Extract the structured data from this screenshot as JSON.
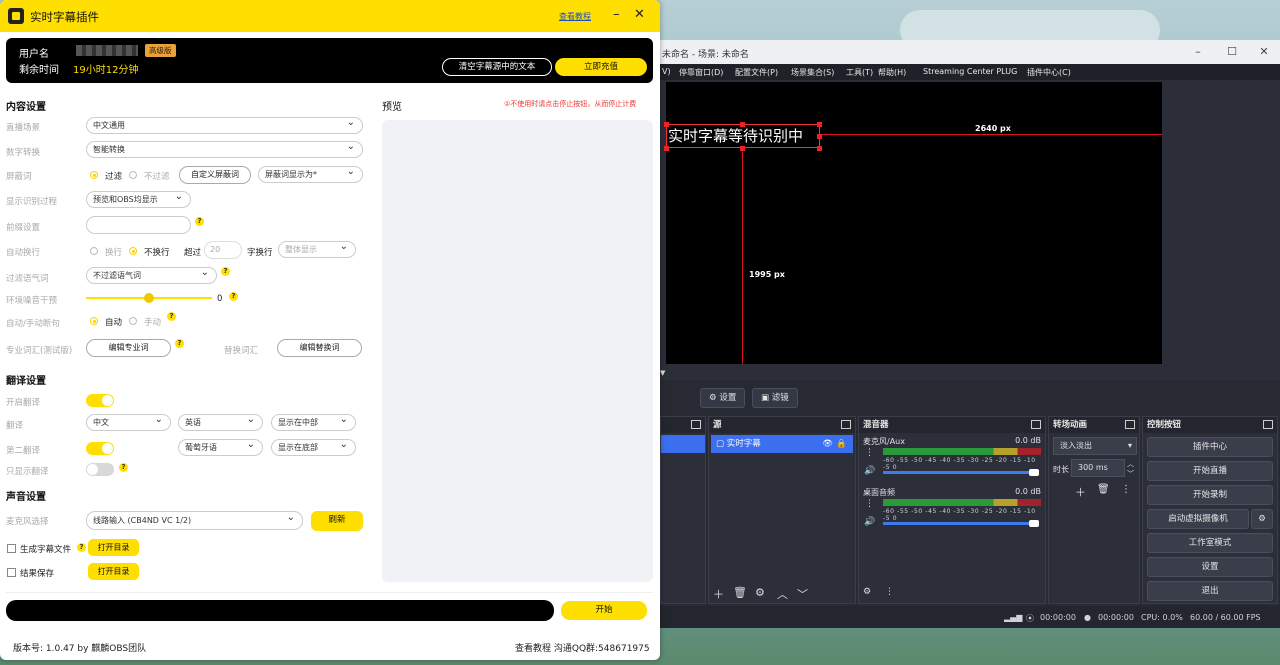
{
  "plugin": {
    "title": "实时字幕插件",
    "tutorial_link": "查看教程",
    "min_icon": "–",
    "close_icon": "✕",
    "account": {
      "user_label": "用户名",
      "vip_badge": "高级版",
      "time_label": "剩余时间",
      "time_value": "19小时12分钟",
      "clear_button": "清空字幕源中的文本",
      "recharge_button": "立即充值"
    },
    "content_settings": {
      "section_title": "内容设置",
      "scene_label": "直播场景",
      "scene_value": "中文通用",
      "number_label": "数字转换",
      "number_value": "智能转换",
      "block_label": "屏蔽词",
      "filter_option": "过滤",
      "no_filter_option": "不过滤",
      "custom_block_button": "自定义屏蔽词",
      "block_display_value": "屏蔽词显示为*",
      "show_process_label": "显示识别过程",
      "show_process_value": "预览和OBS均显示",
      "prefix_label": "前缀设置",
      "prefix_placeholder": "",
      "autowrap_label": "自动换行",
      "wrap_option": "换行",
      "nowrap_option": "不换行",
      "exceed_label": "超过",
      "exceed_value": "20",
      "char_wrap_label": "字换行",
      "whole_display_value": "整体显示",
      "filler_label": "过滤语气词",
      "filler_value": "不过滤语气词",
      "noise_label": "环境噪音干预",
      "noise_value": "0",
      "noise_level": 0.5,
      "sentence_label": "自动/手动断句",
      "auto_option": "自动",
      "manual_option": "手动",
      "term_label": "专业词汇(测试版)",
      "edit_term_button": "编辑专业词",
      "replace_label": "替换词汇",
      "edit_replace_button": "编辑替换词"
    },
    "translation_settings": {
      "section_title": "翻译设置",
      "enable_label": "开启翻译",
      "translate_label": "翻译",
      "source_lang": "中文",
      "target_lang": "英语",
      "position1": "显示在中部",
      "second_label": "第二翻译",
      "second_lang": "葡萄牙语",
      "position2": "显示在底部",
      "only_translation_label": "只显示翻译"
    },
    "audio_settings": {
      "section_title": "声音设置",
      "mic_label": "麦克风选择",
      "mic_value": "线路输入 (CB4ND VC 1/2)",
      "refresh_button": "刷新",
      "subtitle_file_label": "生成字幕文件",
      "open_dir_button": "打开目录",
      "save_result_label": "结果保存",
      "open_dir_button2": "打开目录"
    },
    "preview": {
      "title": "预览",
      "hint": "①不使用时请点击停止按钮，从而停止计费"
    },
    "start_button": "开始",
    "footer_version": "版本号: 1.0.47 by 麒麟OBS团队",
    "footer_right": "查看教程 沟通QQ群:548671975"
  },
  "obs": {
    "title": "未命名 - 场景: 未命名",
    "menu": [
      "V)",
      "停靠窗口(D)",
      "配置文件(P)",
      "场景集合(S)",
      "工具(T)",
      "帮助(H)",
      "Streaming Center PLUG",
      "插件中心(C)"
    ],
    "subtitle_text": "实时字幕等待识别中",
    "width_label": "2640 px",
    "height_label": "1995 px",
    "toolbar": {
      "settings": "设置",
      "filters": "滤镜"
    },
    "sources": {
      "title": "源",
      "item": "实时字幕"
    },
    "mixer": {
      "title": "混音器",
      "ch1_name": "麦克风/Aux",
      "ch1_db": "0.0 dB",
      "ch2_name": "桌面音频",
      "ch2_db": "0.0 dB",
      "scale": "-60 -55 -50 -45 -40 -35 -30 -25 -20 -15 -10 -5 0"
    },
    "transitions": {
      "title": "转场动画",
      "type": "淡入淡出",
      "duration_label": "时长",
      "duration_value": "300 ms"
    },
    "controls": {
      "title": "控制按钮",
      "buttons": [
        "插件中心",
        "开始直播",
        "开始录制",
        "启动虚拟摄像机",
        "工作室模式",
        "设置",
        "退出"
      ]
    },
    "status": {
      "live_time": "00:00:00",
      "rec_time": "00:00:00",
      "cpu": "CPU: 0.0%",
      "fps": "60.00 / 60.00 FPS"
    }
  }
}
